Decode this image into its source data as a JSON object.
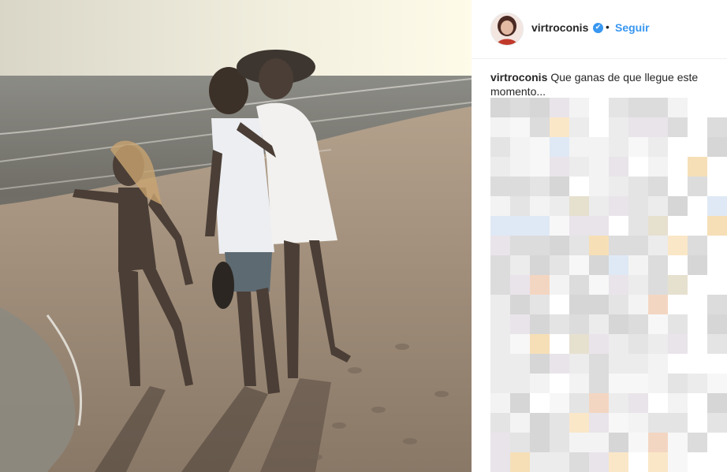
{
  "post": {
    "username": "virtroconis",
    "verified_symbol": "✔",
    "separator": "•",
    "follow_label": "Seguir",
    "caption_user": "virtroconis",
    "caption_text": "Que ganas de que llegue este momento..."
  },
  "icons": {
    "verified": "verified-badge-icon",
    "avatar": "profile-avatar"
  },
  "colors": {
    "accent": "#3897f0",
    "text": "#262626"
  }
}
